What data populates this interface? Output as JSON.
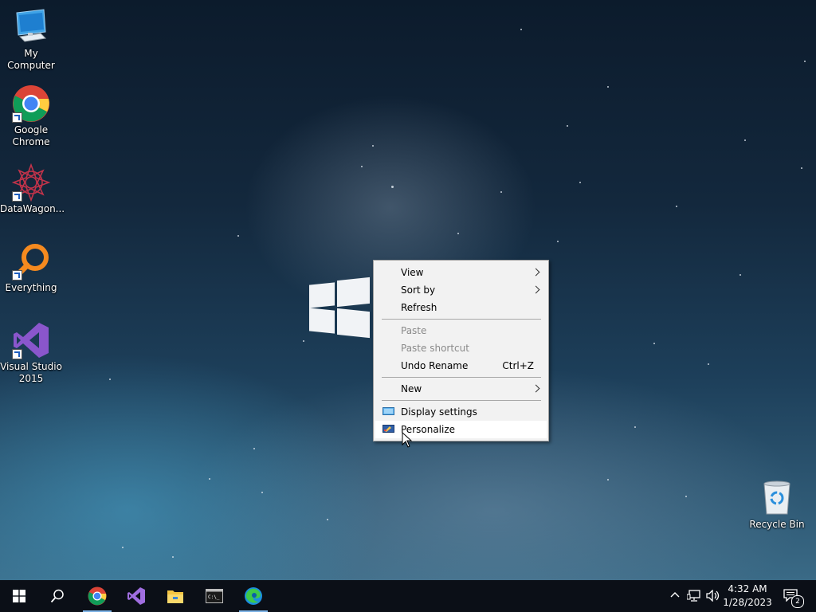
{
  "desktop_icons": [
    {
      "label": "My Computer",
      "icon": "monitor-icon"
    },
    {
      "label": "Google Chrome",
      "icon": "chrome-icon"
    },
    {
      "label": "DataWagon...",
      "icon": "datawagon-icon"
    },
    {
      "label": "Everything",
      "icon": "everything-search-icon"
    },
    {
      "label": "Visual Studio 2015",
      "icon": "visual-studio-icon"
    },
    {
      "label": "Recycle Bin",
      "icon": "recycle-bin-icon"
    }
  ],
  "context_menu": {
    "view": "View",
    "sort_by": "Sort by",
    "refresh": "Refresh",
    "paste": "Paste",
    "paste_shortcut": "Paste shortcut",
    "undo_rename": "Undo Rename",
    "undo_rename_shortcut": "Ctrl+Z",
    "new": "New",
    "display_settings": "Display settings",
    "personalize": "Personalize"
  },
  "taskbar": {
    "pinned": [
      "start-icon",
      "search-icon",
      "chrome-icon",
      "visual-studio-icon",
      "file-explorer-icon",
      "terminal-icon",
      "edge-icon"
    ],
    "time": "4:32 AM",
    "date": "1/28/2023",
    "notification_count": "2"
  },
  "colors": {
    "menu_bg": "#f2f2f2",
    "taskbar_bg": "#0b0f17",
    "accent": "#7bb2e6"
  }
}
